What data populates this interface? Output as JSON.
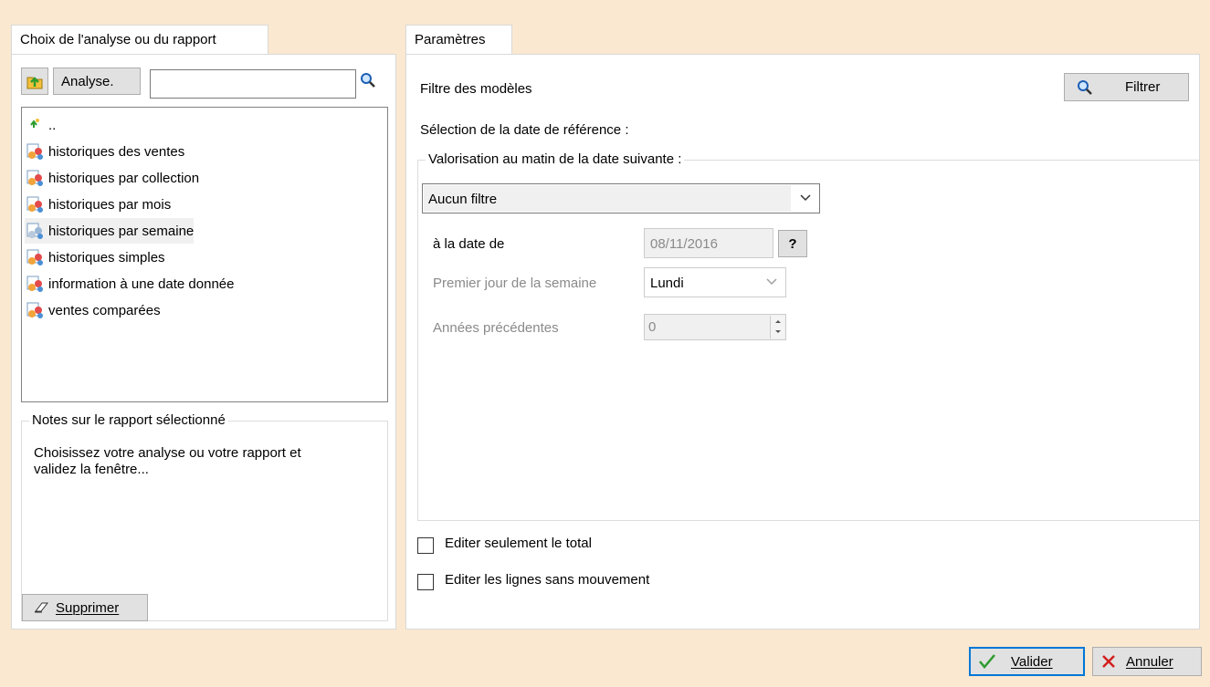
{
  "left_tab": {
    "label": "Choix de l'analyse ou du rapport"
  },
  "left_toolbar": {
    "analyse_label": "Analyse.",
    "search_value": ""
  },
  "list": {
    "items": [
      {
        "label": ".."
      },
      {
        "label": "historiques des ventes"
      },
      {
        "label": "historiques par collection"
      },
      {
        "label": "historiques par mois"
      },
      {
        "label": "historiques par semaine"
      },
      {
        "label": "historiques simples"
      },
      {
        "label": "information à une date donnée"
      },
      {
        "label": "ventes comparées"
      }
    ],
    "selected_index": 4
  },
  "notes": {
    "legend": "Notes sur le rapport sélectionné",
    "text_line1": "Choisissez votre analyse ou votre rapport et",
    "text_line2": "validez la fenêtre...",
    "delete_label": "Supprimer"
  },
  "right_tab": {
    "label": "Paramètres"
  },
  "params": {
    "filter_models_label": "Filtre des modèles",
    "filter_button": "Filtrer",
    "date_reference_label": "Sélection de la date de référence :",
    "valorisation_legend": "Valorisation au matin de la date suivante :",
    "filter_select_value": "Aucun filtre",
    "date_label": "à la date de",
    "date_value": "08/11/2016",
    "help_label": "?",
    "first_day_label": "Premier jour de la semaine",
    "first_day_value": "Lundi",
    "previous_years_label": "Années précédentes",
    "previous_years_value": "0",
    "checkbox1_label": "Editer seulement le total",
    "checkbox1_checked": false,
    "checkbox2_label": "Editer les lignes sans mouvement",
    "checkbox2_checked": false
  },
  "footer": {
    "validate_label": "Valider",
    "cancel_label": "Annuler"
  },
  "colors": {
    "background": "#fae8d0",
    "validate_check": "#2e9b2e",
    "cancel_x": "#d31f1f",
    "focus_border": "#0078d7"
  }
}
